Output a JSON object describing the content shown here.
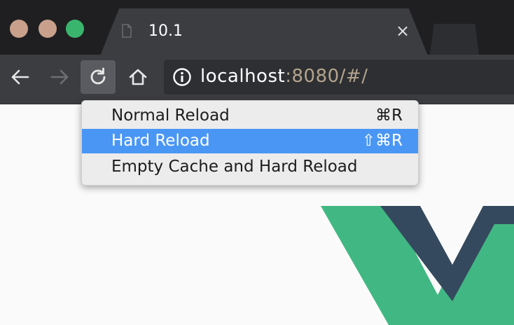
{
  "window": {
    "tab": {
      "title": "10.1",
      "close_glyph": "×",
      "icon": "page-icon"
    }
  },
  "toolbar": {
    "back_icon": "back-arrow-icon",
    "forward_icon": "forward-arrow-icon",
    "reload_icon": "reload-icon",
    "home_icon": "home-icon"
  },
  "omnibox": {
    "info_icon": "info-icon",
    "url_host": "localhost",
    "url_rest": ":8080/#/"
  },
  "context_menu": {
    "items": [
      {
        "label": "Normal Reload",
        "shortcut": "⌘R",
        "highlighted": false
      },
      {
        "label": "Hard Reload",
        "shortcut": "⇧⌘R",
        "highlighted": true
      },
      {
        "label": "Empty Cache and Hard Reload",
        "shortcut": "",
        "highlighted": false
      }
    ]
  },
  "page": {
    "logo": "vue-logo"
  },
  "colors": {
    "titlebar": "#1f1f21",
    "toolbar": "#3c3d41",
    "menu_highlight": "#4a96f5",
    "vue_green": "#41b883",
    "vue_dark": "#35495e"
  }
}
